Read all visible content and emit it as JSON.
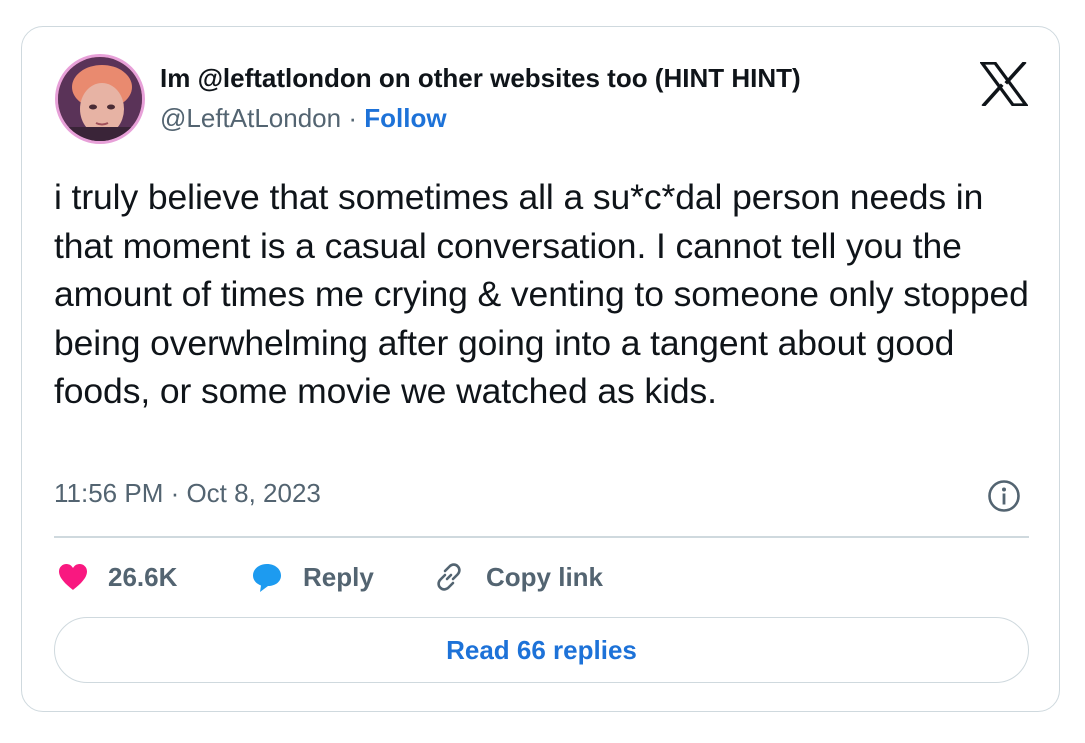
{
  "tweet": {
    "author": {
      "display_name": "Im @leftatlondon on other websites too (HINT HINT)",
      "handle": "@LeftAtLondon",
      "separator": "·",
      "follow_label": "Follow",
      "avatar_icon": "user-avatar"
    },
    "brand_icon": "x-logo-icon",
    "text": "i truly believe that sometimes all a su*c*dal person needs in that moment is a casual conversation. I cannot tell you the amount of times me crying & venting to someone only stopped being overwhelming after going into a tangent about good foods, or some movie we watched as kids.",
    "timestamp": "11:56 PM · Oct 8, 2023",
    "info_icon": "info-icon",
    "actions": {
      "like_count": "26.6K",
      "like_icon": "heart-icon",
      "reply_label": "Reply",
      "reply_icon": "speech-bubble-icon",
      "copy_label": "Copy link",
      "copy_icon": "link-icon"
    },
    "read_replies_label": "Read 66 replies"
  },
  "colors": {
    "text_primary": "#0f1419",
    "text_secondary": "#536471",
    "link_blue": "#1d72d8",
    "heart_pink": "#f91880",
    "reply_blue": "#1d9bf0",
    "border": "#cfd9de"
  }
}
